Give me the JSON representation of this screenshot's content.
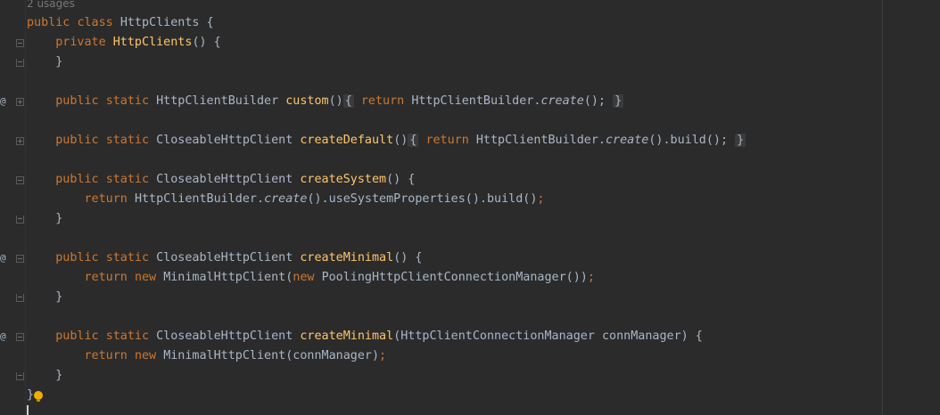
{
  "usages_hint": "2 usages",
  "code": {
    "class_decl": {
      "kw1": "public",
      "kw2": "class",
      "name": "HttpClients",
      "brace": " {"
    },
    "ctor": {
      "kw": "private",
      "name": "HttpClients",
      "rest": "() {"
    },
    "close1": "}",
    "custom": {
      "kw1": "public",
      "kw2": "static",
      "type": "HttpClientBuilder",
      "name": "custom",
      "paren": "()",
      "ob": "{",
      "ret": "return",
      "call_pre": "HttpClientBuilder.",
      "call_it": "create",
      "call_post": "();",
      "cb": "}"
    },
    "createDefault": {
      "kw1": "public",
      "kw2": "static",
      "type": "CloseableHttpClient",
      "name": "createDefault",
      "paren": "()",
      "ob": "{",
      "ret": "return",
      "call_pre": "HttpClientBuilder.",
      "call_it": "create",
      "call_post": "().build();",
      "cb": "}"
    },
    "createSystem": {
      "kw1": "public",
      "kw2": "static",
      "type": "CloseableHttpClient",
      "name": "createSystem",
      "rest": "() {"
    },
    "createSystem_body": {
      "ret": "return",
      "call_pre": "HttpClientBuilder.",
      "call_it": "create",
      "call_post": "().useSystemProperties().build()",
      "semi": ";"
    },
    "close2": "}",
    "createMinimal1": {
      "kw1": "public",
      "kw2": "static",
      "type": "CloseableHttpClient",
      "name": "createMinimal",
      "rest": "() {"
    },
    "createMinimal1_body": {
      "ret": "return",
      "new1": "new",
      "cls": "MinimalHttpClient(",
      "new2": "new",
      "arg": "PoolingHttpClientConnectionManager())",
      "semi": ";"
    },
    "close3": "}",
    "createMinimal2": {
      "kw1": "public",
      "kw2": "static",
      "type": "CloseableHttpClient",
      "name": "createMinimal",
      "rest": "(HttpClientConnectionManager connManager) {"
    },
    "createMinimal2_body": {
      "ret": "return",
      "new1": "new",
      "rest": "MinimalHttpClient(connManager)",
      "semi": ";"
    },
    "close4": "}",
    "class_close": "}"
  },
  "icons": {
    "override": "at-icon",
    "fold": "fold-icon",
    "intention": "lightbulb-icon"
  },
  "colors": {
    "background": "#2b2b2b",
    "keyword": "#cc7832",
    "function": "#ffc66d",
    "text": "#a9b7c6"
  }
}
